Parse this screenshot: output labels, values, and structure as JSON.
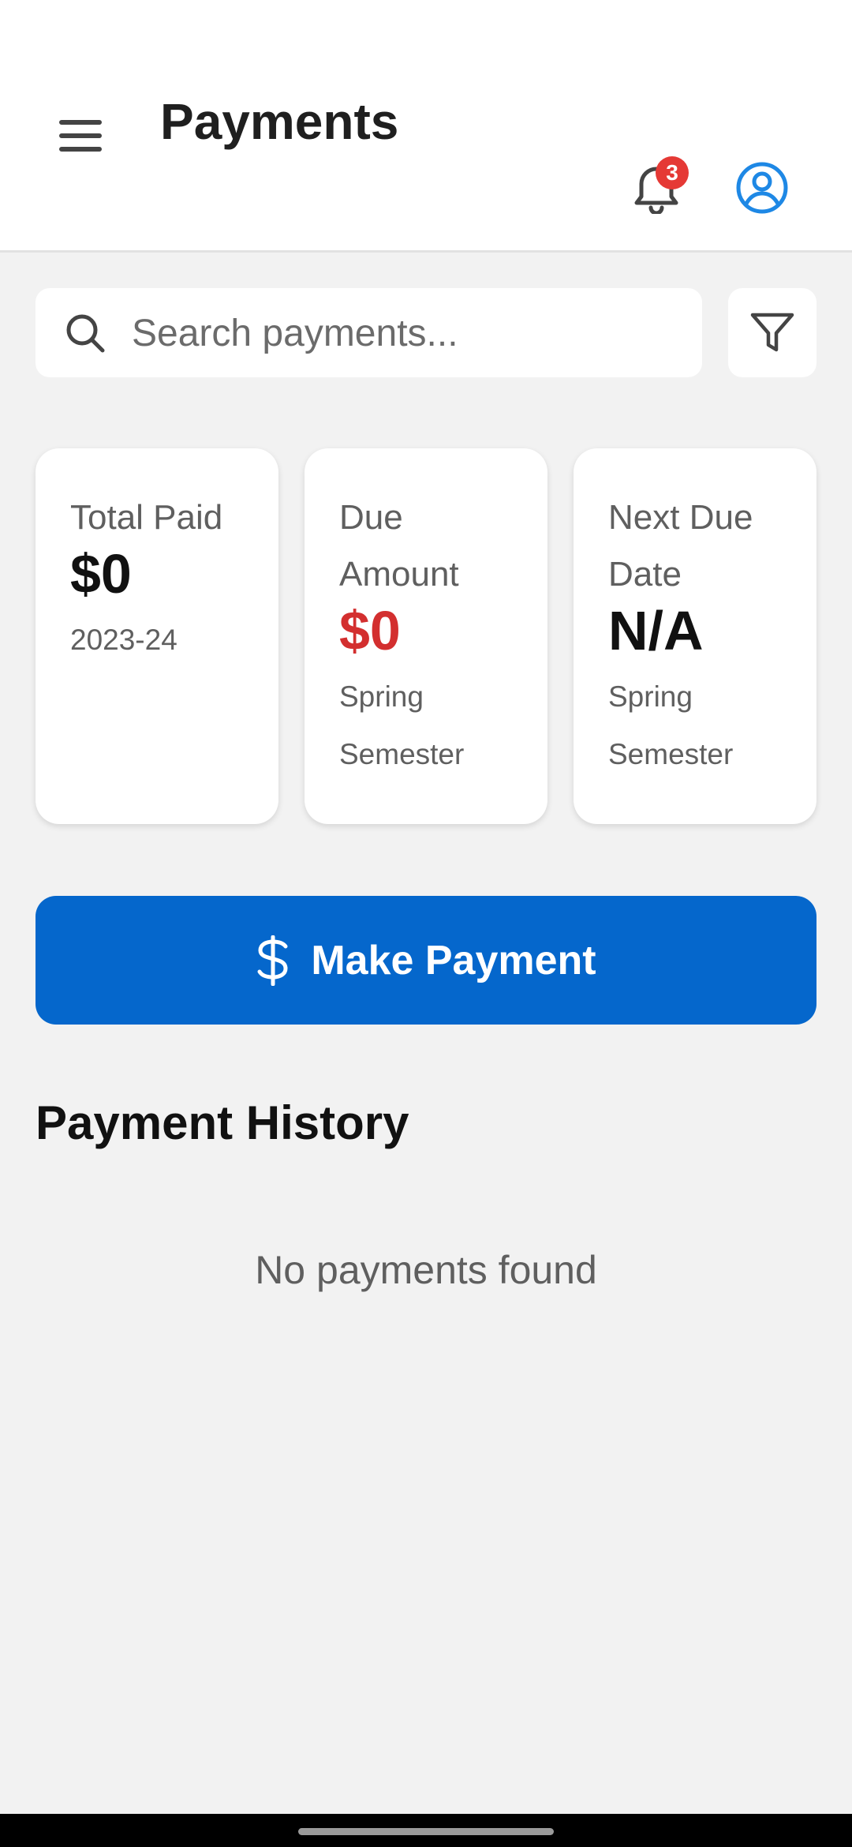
{
  "header": {
    "title": "Payments",
    "notification_count": "3"
  },
  "search": {
    "placeholder": "Search payments...",
    "value": ""
  },
  "summary_cards": [
    {
      "label": "Total Paid",
      "value": "$0",
      "sub": "2023-24"
    },
    {
      "label": "Due Amount",
      "value": "$0",
      "sub": "Spring Semester",
      "value_color": "#d32f2f"
    },
    {
      "label": "Next Due Date",
      "value": "N/A",
      "sub": "Spring Semester"
    }
  ],
  "actions": {
    "make_payment_label": "Make Payment",
    "make_payment_icon": "dollar-icon"
  },
  "history": {
    "title": "Payment History",
    "empty_message": "No payments found"
  },
  "colors": {
    "primary": "#0567cc",
    "accent_profile": "#1e88e5",
    "danger": "#d32f2f",
    "badge": "#e53935"
  },
  "icons": {
    "menu": "menu-icon",
    "notifications": "bell-icon",
    "profile": "account-circle-icon",
    "search": "search-icon",
    "filter": "filter-icon"
  }
}
